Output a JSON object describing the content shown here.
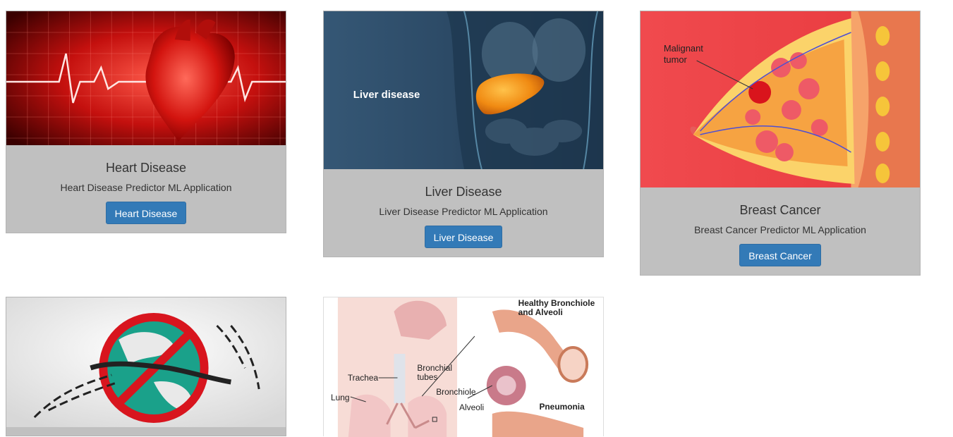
{
  "cards": [
    {
      "title": "Heart Disease",
      "description": "Heart Disease Predictor ML Application",
      "button": "Heart Disease"
    },
    {
      "title": "Liver Disease",
      "description": "Liver Disease Predictor ML Application",
      "button": "Liver Disease",
      "image_caption": "Liver disease"
    },
    {
      "title": "Breast Cancer",
      "description": "Breast Cancer Predictor ML Application",
      "button": "Breast Cancer",
      "image_labels": {
        "tumor_line1": "Malignant",
        "tumor_line2": "tumor"
      }
    },
    {
      "title": "",
      "description": "",
      "button": ""
    },
    {
      "title": "",
      "description": "",
      "button": "",
      "image_labels": {
        "healthy_line1": "Healthy Bronchiole",
        "healthy_line2": "and Alveoli",
        "trachea": "Trachea",
        "bronchial_line1": "Bronchial",
        "bronchial_line2": "tubes",
        "bronchiole": "Bronchiole",
        "lung": "Lung",
        "alveoli": "Alveoli",
        "pneumonia": "Pneumonia"
      }
    }
  ],
  "colors": {
    "button": "#337ab7",
    "card_body": "#c0c0c0"
  }
}
